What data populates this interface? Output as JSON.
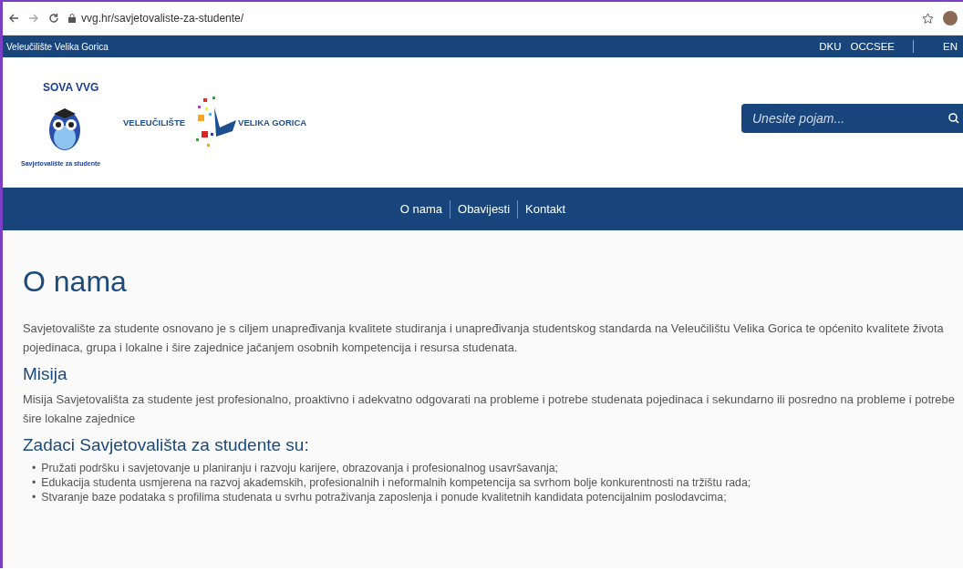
{
  "browser": {
    "url": "vvg.hr/savjetovaliste-za-studente/"
  },
  "top_bar": {
    "site_name": "Veleučilište Velika Gorica",
    "links": [
      "DKU",
      "OCCSEE"
    ],
    "language": "EN"
  },
  "header": {
    "owl_logo": {
      "arc_text": "SOVA VVG",
      "ring_text": "Savjetovalište za studente"
    },
    "logo": {
      "left": "VELEUČILIŠTE",
      "right": "VELIKA GORICA"
    },
    "search": {
      "placeholder": "Unesite pojam..."
    }
  },
  "nav": [
    {
      "label": "O nama",
      "selected": false
    },
    {
      "label": "Obavijesti",
      "selected": false
    },
    {
      "label": "Kontakt",
      "selected": false
    }
  ],
  "content": {
    "title": "O nama",
    "intro": "Savjetovalište za studente osnovano je s ciljem unapređivanja kvalitete studiranja i unapređivanja studentskog standarda na Veleučilištu Velika Gorica te općenito kvalitete života pojedinaca, grupa i lokalne i šire zajednice jačanjem osobnih kompetencija i resursa studenata.",
    "sections": [
      {
        "heading": "Misija",
        "text": "Misija Savjetovališta za studente jest profesionalno, proaktivno i adekvatno odgovarati na probleme i potrebe studenata pojedinaca i sekundarno ili posredno na probleme i potrebe šire lokalne zajednice"
      },
      {
        "heading": "Zadaci Savjetovališta za studente su:",
        "bullet": "•",
        "items": [
          "Pružati podršku i savjetovanje u planiranju i razvoju karijere, obrazovanja i profesionalnog usavršavanja;",
          "Edukacija studenta usmjerena na razvoj akademskih, profesionalnih i neformalnih kompetencija sa svrhom bolje konkurentnosti na tržištu rada;",
          "Stvaranje baze podataka s profilima studenata u svrhu potraživanja zaposlenja i ponude kvalitetnih kandidata potencijalnim poslodavcima;"
        ]
      }
    ]
  }
}
